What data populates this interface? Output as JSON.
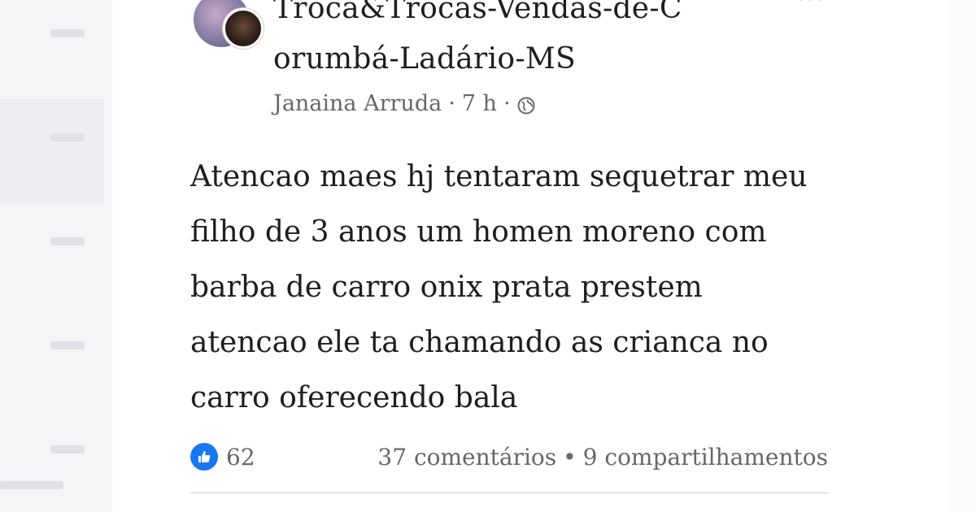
{
  "post": {
    "group_name": "Troca&Trocas-Vendas-de-C\norumbá-Ladário-MS",
    "author": "Janaina Arruda",
    "time": "7 h",
    "separator": "·",
    "body": "Atencao maes hj tentaram sequetrar meu\nfilho de 3 anos  um homen moreno com\nbarba de carro onix prata prestem\natencao ele ta chamando as crianca no\ncarro oferecendo bala",
    "reactions_count": "62",
    "comments": "37 comentários",
    "shares": "9 compartilhamentos",
    "stats_separator": "•",
    "menu": "···"
  },
  "icons": {
    "privacy": "globe-icon",
    "reaction": "like-icon",
    "like_color": "#1877f2"
  }
}
